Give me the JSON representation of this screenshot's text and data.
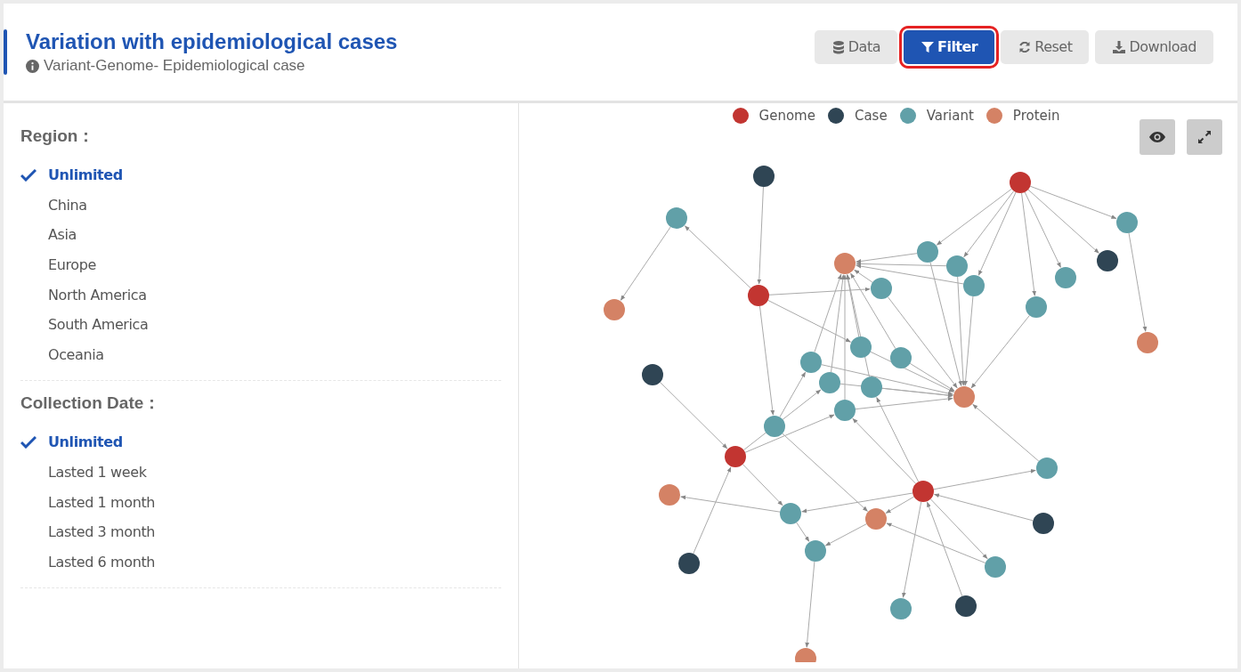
{
  "header": {
    "title": "Variation with epidemiological cases",
    "subtitle": "Variant-Genome- Epidemiological case",
    "buttons": [
      {
        "label": "Data",
        "kind": "database",
        "selected": false
      },
      {
        "label": "Filter",
        "kind": "filter",
        "selected": true
      },
      {
        "label": "Reset",
        "kind": "refresh",
        "selected": false
      },
      {
        "label": "Download",
        "kind": "download",
        "selected": false
      }
    ]
  },
  "filters": [
    {
      "title": "Region：",
      "options": [
        {
          "label": "Unlimited",
          "selected": true
        },
        {
          "label": "China",
          "selected": false
        },
        {
          "label": "Asia",
          "selected": false
        },
        {
          "label": "Europe",
          "selected": false
        },
        {
          "label": "North America",
          "selected": false
        },
        {
          "label": "South America",
          "selected": false
        },
        {
          "label": "Oceania",
          "selected": false
        }
      ]
    },
    {
      "title": "Collection Date：",
      "options": [
        {
          "label": "Unlimited",
          "selected": true
        },
        {
          "label": "Lasted 1 week",
          "selected": false
        },
        {
          "label": "Lasted 1 month",
          "selected": false
        },
        {
          "label": "Lasted 3 month",
          "selected": false
        },
        {
          "label": "Lasted 6 month",
          "selected": false
        }
      ]
    }
  ],
  "graph": {
    "legend": [
      {
        "label": "Genome",
        "color": "#c23531"
      },
      {
        "label": "Case",
        "color": "#2f4554"
      },
      {
        "label": "Variant",
        "color": "#61a0a8"
      },
      {
        "label": "Protein",
        "color": "#d48265"
      }
    ]
  }
}
